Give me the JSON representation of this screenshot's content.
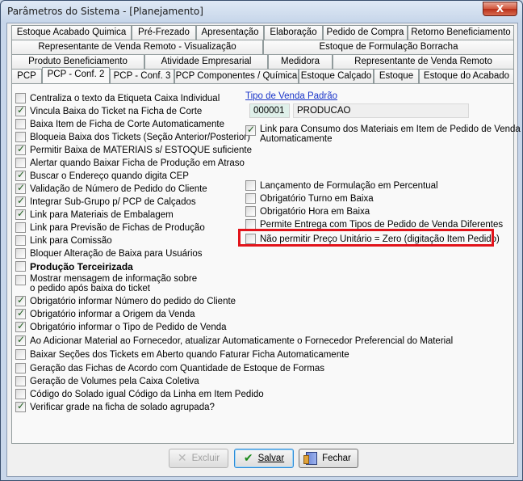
{
  "window": {
    "title": "Parâmetros do Sistema - [Planejamento]",
    "close_label": "X"
  },
  "tabs": {
    "row1": [
      "Estoque Acabado Quimica",
      "Pré-Frezado",
      "Apresentação",
      "Elaboração",
      "Pedido de Compra",
      "Retorno Beneficiamento"
    ],
    "row2": [
      "Representante de Venda Remoto - Visualização",
      "Estoque de Formulação Borracha"
    ],
    "row3": [
      "Produto Beneficiamento",
      "Atividade Empresarial",
      "Medidora",
      "Representante de Venda Remoto"
    ],
    "row4": [
      "PCP",
      "PCP - Conf. 2",
      "PCP - Conf. 3",
      "PCP Componentes / Química",
      "Estoque Calçado",
      "Estoque",
      "Estoque do Acabado"
    ]
  },
  "left_options": [
    {
      "label": "Centraliza o texto da Etiqueta Caixa Individual",
      "checked": false
    },
    {
      "label": "Vincula Baixa do Ticket na Ficha de Corte",
      "checked": true
    },
    {
      "label": "Baixa Item de Ficha de Corte Automaticamente",
      "checked": false
    },
    {
      "label": "Bloqueia Baixa dos Tickets (Seção Anterior/Posterior)",
      "checked": false
    },
    {
      "label": "Permitir Baixa de MATERIAIS s/ ESTOQUE suficiente",
      "checked": true
    },
    {
      "label": "Alertar quando Baixar Ficha de Produção em Atraso",
      "checked": false
    },
    {
      "label": "Buscar o Endereço quando digita CEP",
      "checked": true
    },
    {
      "label": "Validação de Número de Pedido do Cliente",
      "checked": true
    },
    {
      "label": "Integrar Sub-Grupo p/ PCP de Calçados",
      "checked": true
    },
    {
      "label": "Link para Materiais de Embalagem",
      "checked": true
    },
    {
      "label": "Link para Previsão de Fichas de Produção",
      "checked": false
    },
    {
      "label": "Link para Comissão",
      "checked": false
    },
    {
      "label": "Bloquer Alteração de Baixa para Usuários",
      "checked": false
    }
  ],
  "producao_terceirizada": {
    "label": "Produção Terceirizada",
    "checked": false
  },
  "mostrar_mensagem": {
    "line1": "Mostrar mensagem de informação sobre",
    "line2": "o pedido após baixa do ticket",
    "checked": false
  },
  "lower_options": [
    {
      "label": "Obrigatório informar Número do pedido do Cliente",
      "checked": true
    },
    {
      "label": "Obrigatório informar a Origem da Venda",
      "checked": true
    },
    {
      "label": "Obrigatório informar o Tipo de Pedido de Venda",
      "checked": true
    },
    {
      "label": "Ao Adicionar Material ao Fornecedor, atualizar Automaticamente o Fornecedor Preferencial do Material",
      "checked": true
    },
    {
      "label": "Baixar Seções dos Tickets em Aberto quando Faturar Ficha Automaticamente",
      "checked": false
    },
    {
      "label": "Geração das Fichas de Acordo com Quantidade de Estoque de Formas",
      "checked": false
    },
    {
      "label": "Geração de Volumes pela Caixa Coletiva",
      "checked": false
    },
    {
      "label": "Código do Solado igual Código da Linha em Item Pedido",
      "checked": false
    },
    {
      "label": "Verificar grade na ficha de solado agrupada?",
      "checked": true
    }
  ],
  "tipo_venda": {
    "label": "Tipo de Venda Padrão",
    "code": "000001",
    "name": "PRODUCAO"
  },
  "right_link_consumo": {
    "line1": "Link para Consumo dos Materiais em Item de Pedido de Venda",
    "line2": "Automaticamente",
    "checked": true
  },
  "right_options": [
    {
      "label": "Lançamento de Formulação em Percentual",
      "checked": false
    },
    {
      "label": "Obrigatório Turno em Baixa",
      "checked": false
    },
    {
      "label": "Obrigatório Hora em Baixa",
      "checked": false
    },
    {
      "label": "Permite Entrega com Tipos de Pedido de Venda Diferentes",
      "checked": false
    },
    {
      "label": "Não permitir Preço Unitário = Zero (digitação Item Pedido)",
      "checked": false
    }
  ],
  "buttons": {
    "excluir": "Excluir",
    "salvar": "Salvar",
    "fechar": "Fechar"
  },
  "colors": {
    "highlight": "#e2141b",
    "link": "#1a35c9"
  }
}
